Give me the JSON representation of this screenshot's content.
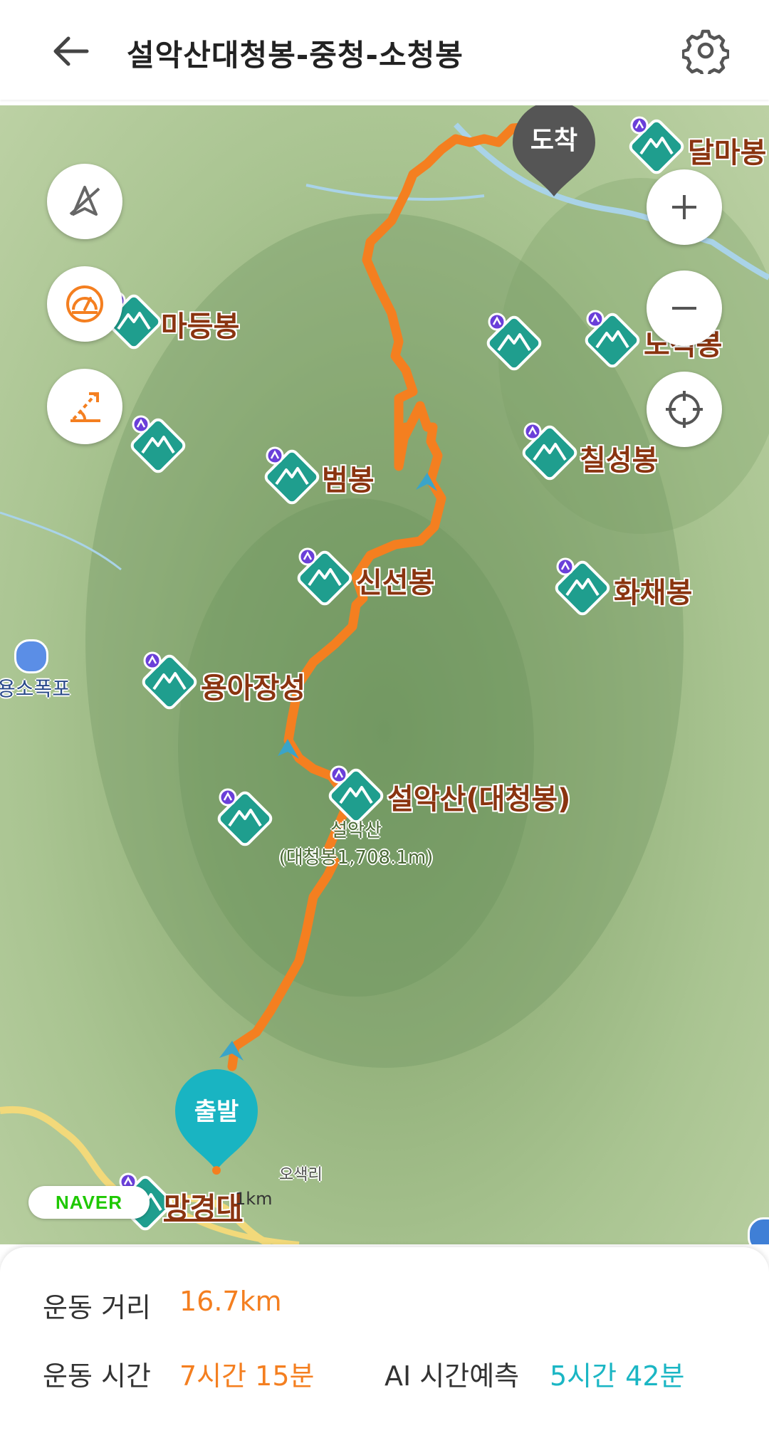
{
  "header": {
    "title": "설악산대청봉-중청-소청봉",
    "back_icon": "arrow-left-icon",
    "settings_icon": "gear-icon"
  },
  "map": {
    "markers": {
      "start": "출발",
      "end": "도착"
    },
    "peaks": [
      {
        "name": "달마봉"
      },
      {
        "name": "마등봉"
      },
      {
        "name": "노적봉"
      },
      {
        "name": "칠성봉"
      },
      {
        "name": "범봉"
      },
      {
        "name": "신선봉"
      },
      {
        "name": "화채봉"
      },
      {
        "name": "용아장성"
      },
      {
        "name": "설악산(대청봉)"
      },
      {
        "name": "망경대"
      }
    ],
    "places": {
      "waterfall": "용소폭포",
      "village": "오색리",
      "summit_line1": "설악산",
      "summit_line2": "(대청봉1,708.1m)"
    },
    "attribution": "NAVER",
    "scale": "1km",
    "route_color": "#f47f20",
    "left_controls": [
      "compass-off-icon",
      "speedometer-icon",
      "slope-icon"
    ],
    "right_controls": [
      "zoom-in-icon",
      "zoom-out-icon",
      "locate-crosshair-icon"
    ]
  },
  "stats": {
    "distance_label": "운동 거리",
    "distance_value": "16.7km",
    "time_label": "운동 시간",
    "time_value": "7시간 15분",
    "ai_label": "AI 시간예측",
    "ai_value": "5시간 42분"
  }
}
